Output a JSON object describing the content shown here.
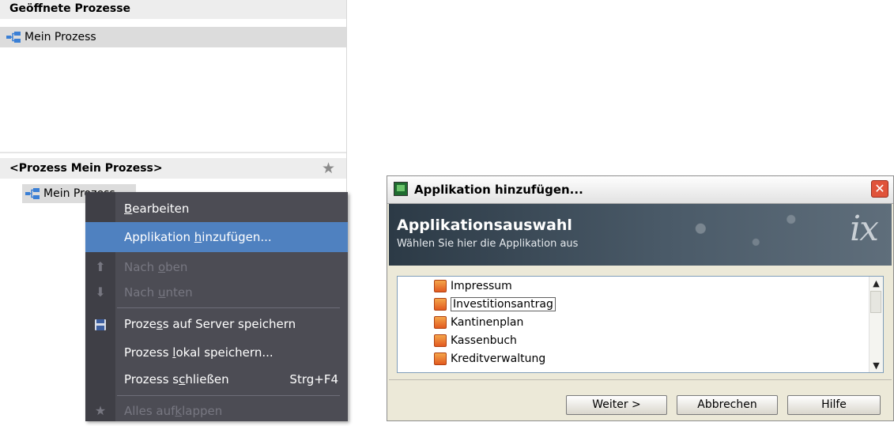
{
  "left_panel": {
    "open_processes_header": "Geöffnete Prozesse",
    "open_process_item": "Mein Prozess",
    "process_header": "<Prozess Mein Prozess>",
    "tree_item": "Mein Prozess"
  },
  "context_menu": {
    "items": [
      {
        "pre": "",
        "key": "B",
        "post": "earbeiten",
        "shortcut": "",
        "enabled": true,
        "icon": ""
      },
      {
        "pre": "Applikation ",
        "key": "h",
        "post": "inzufügen...",
        "shortcut": "",
        "enabled": true,
        "highlighted": true,
        "icon": ""
      },
      {
        "pre": "Nach ",
        "key": "o",
        "post": "ben",
        "shortcut": "",
        "enabled": false,
        "icon": "arrow-up-icon"
      },
      {
        "pre": "Nach ",
        "key": "u",
        "post": "nten",
        "shortcut": "",
        "enabled": false,
        "icon": "arrow-down-icon"
      },
      {
        "pre": "Proze",
        "key": "s",
        "post": "s auf Server speichern",
        "shortcut": "",
        "enabled": true,
        "icon": "floppy-disk-icon"
      },
      {
        "pre": "Prozess ",
        "key": "l",
        "post": "okal speichern...",
        "shortcut": "",
        "enabled": true,
        "icon": ""
      },
      {
        "pre": "Prozess s",
        "key": "c",
        "post": "hließen",
        "shortcut": "Strg+F4",
        "enabled": true,
        "icon": ""
      },
      {
        "pre": "Alles auf",
        "key": "k",
        "post": "lappen",
        "shortcut": "",
        "enabled": false,
        "icon": "star-icon"
      }
    ]
  },
  "dialog": {
    "title": "Applikation hinzufügen...",
    "banner_title": "Applikationsauswahl",
    "banner_subtitle": "Wählen Sie hier die Applikation aus",
    "banner_logo": "ix",
    "list_items": [
      "Impressum",
      "Investitionsantrag",
      "Kantinenplan",
      "Kassenbuch",
      "Kreditverwaltung"
    ],
    "selected_item": "Investitionsantrag",
    "buttons": {
      "next": "Weiter >",
      "cancel": "Abbrechen",
      "help": "Hilfe"
    },
    "close_glyph": "✕"
  },
  "colors": {
    "menu_background": "#4c4c54",
    "menu_highlight": "#4f81c0",
    "section_header": "#ededed",
    "close_button": "#e0533a"
  }
}
